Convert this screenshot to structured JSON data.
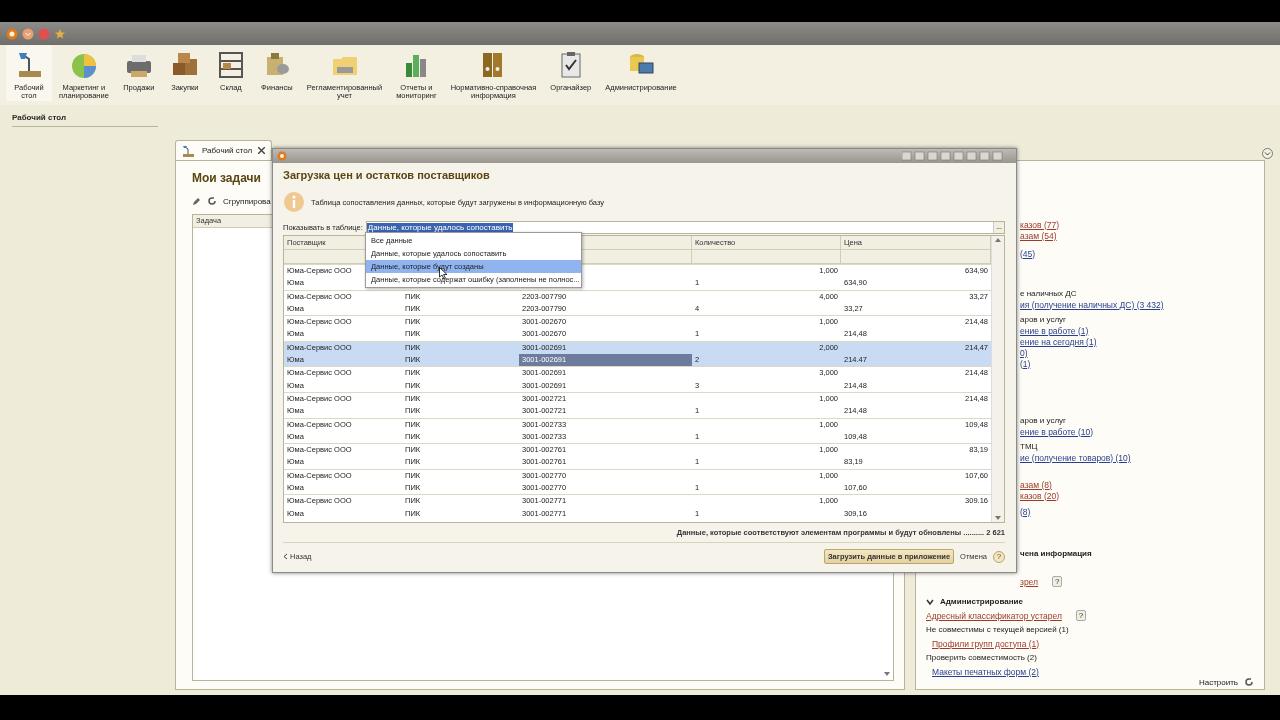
{
  "sections": [
    {
      "label": "Рабочий\nстол",
      "selected": true
    },
    {
      "label": "Маркетинг и\nпланирование",
      "selected": false
    },
    {
      "label": "Продажи",
      "selected": false
    },
    {
      "label": "Закупки",
      "selected": false
    },
    {
      "label": "Склад",
      "selected": false
    },
    {
      "label": "Финансы",
      "selected": false
    },
    {
      "label": "Регламентированный\nучет",
      "selected": false
    },
    {
      "label": "Отчеты и\nмониторинг",
      "selected": false
    },
    {
      "label": "Нормативно-справочная\nинформация",
      "selected": false
    },
    {
      "label": "Органайзер",
      "selected": false
    },
    {
      "label": "Администрирование",
      "selected": false
    }
  ],
  "sidebar": {
    "title": "Рабочий стол"
  },
  "tab": {
    "label": "Рабочий стол",
    "selected": true
  },
  "tasks_panel": {
    "title": "Мои задачи",
    "group_button": "Сгруппирова",
    "column": "Задача"
  },
  "right_panel": {
    "clipped_groups": [
      [
        {
          "kind": "link",
          "text": "казов (77)",
          "color": "#9b3b2a"
        },
        {
          "kind": "link",
          "text": "азам (54)",
          "color": "#9b3b2a"
        }
      ],
      [
        {
          "kind": "link",
          "text": "(45)",
          "color": "#2b3f8f"
        }
      ],
      [
        {
          "kind": "label",
          "text": "е наличных ДС"
        },
        {
          "kind": "link",
          "text": "ия (получение наличных ДС) (3 432)",
          "color": "#2b3f8f"
        }
      ],
      [
        {
          "kind": "label",
          "text": "аров и услуг"
        },
        {
          "kind": "link",
          "text": "ение в работе (1)",
          "color": "#2b3f8f"
        },
        {
          "kind": "link",
          "text": "ение на сегодня (1)",
          "color": "#2b3f8f"
        },
        {
          "kind": "link",
          "text": "0)",
          "color": "#2b3f8f"
        },
        {
          "kind": "link",
          "text": "(1)",
          "color": "#2b3f8f"
        }
      ],
      [
        {
          "kind": "label",
          "text": "аров и услуг"
        },
        {
          "kind": "link",
          "text": "ение в работе (10)",
          "color": "#2b3f8f"
        }
      ],
      [
        {
          "kind": "label",
          "text": "ТМЦ"
        },
        {
          "kind": "link",
          "text": "ие (получение товаров) (10)",
          "color": "#2b3f8f"
        }
      ],
      [
        {
          "kind": "link",
          "text": "азам (8)",
          "color": "#9b3b2a"
        },
        {
          "kind": "link",
          "text": "казов (20)",
          "color": "#9b3b2a"
        }
      ],
      [
        {
          "kind": "link",
          "text": "(8)",
          "color": "#2b3f8f"
        }
      ],
      [
        {
          "kind": "heading",
          "text": "чена информация"
        }
      ],
      [
        {
          "kind": "link",
          "text": "зрел",
          "color": "#9b3b2a",
          "help": "?"
        }
      ]
    ],
    "admin": {
      "title": "Администрирование",
      "expanded": true,
      "items": [
        {
          "kind": "link",
          "text": "Адресный классификатор устарел",
          "color": "#9b3b2a",
          "help": "?"
        },
        {
          "kind": "label",
          "text": "Не совместимы с текущей версией (1)"
        },
        {
          "kind": "sublink",
          "text": "Профили групп доступа (1)",
          "color": "#9b3b2a"
        },
        {
          "kind": "label",
          "text": "Проверить совместимость (2)"
        },
        {
          "kind": "sublink",
          "text": "Макеты печатных форм (2)",
          "color": "#2b3f8f"
        }
      ]
    },
    "settings_button": "Настроить"
  },
  "dialog": {
    "heading": "Загрузка цен и остатков поставщиков",
    "info": "Таблица сопоставления данных, которые будут загружены в информационную базу",
    "filter": {
      "label": "Показывать в таблице:",
      "value": "Данные, которые удалось сопоставить",
      "choice_button": "..."
    },
    "dropdown": [
      {
        "text": "Все данные",
        "selected": false
      },
      {
        "text": "Данные, которые удалось сопоставить",
        "selected": false
      },
      {
        "text": "Данные, которые будут созданы",
        "selected": true
      },
      {
        "text": "Данные, которые содержат ошибку (заполнены не полнос...",
        "selected": false
      }
    ],
    "columns": {
      "supplier": "Поставщик",
      "quantity": "Количество",
      "price": "Цена"
    },
    "records": [
      {
        "selected": false,
        "top": {
          "supplier": "Юма-Сервис ООО",
          "quantity": "1,000",
          "price": "634,90"
        },
        "bottom": {
          "supplier": "Юма",
          "quantity": "1",
          "price": "634,90"
        }
      },
      {
        "selected": false,
        "top": {
          "supplier": "Юма-Сервис ООО",
          "column_2": "ПИК",
          "column_3": "2203-007790",
          "quantity": "4,000",
          "price": "33,27"
        },
        "bottom": {
          "supplier": "Юма",
          "column_2": "ПИК",
          "column_3": "2203-007790",
          "quantity": "4",
          "price": "33,27"
        }
      },
      {
        "selected": false,
        "top": {
          "supplier": "Юма-Сервис ООО",
          "column_2": "ПИК",
          "column_3": "3001-002670",
          "quantity": "1,000",
          "price": "214,48"
        },
        "bottom": {
          "supplier": "Юма",
          "column_2": "ПИК",
          "column_3": "3001-002670",
          "quantity": "1",
          "price": "214,48"
        }
      },
      {
        "selected": true,
        "top": {
          "supplier": "Юма-Сервис ООО",
          "column_2": "ПИК",
          "column_3": "3001-002691",
          "quantity": "2,000",
          "price": "214,47"
        },
        "bottom": {
          "supplier": "Юма",
          "column_2": "ПИК",
          "column_3": "3001-002691",
          "quantity": "2",
          "price": "214.47"
        }
      },
      {
        "selected": false,
        "top": {
          "supplier": "Юма-Сервис ООО",
          "column_2": "ПИК",
          "column_3": "3001-002691",
          "quantity": "3,000",
          "price": "214,48"
        },
        "bottom": {
          "supplier": "Юма",
          "column_2": "ПИК",
          "column_3": "3001-002691",
          "quantity": "3",
          "price": "214,48"
        }
      },
      {
        "selected": false,
        "top": {
          "supplier": "Юма-Сервис ООО",
          "column_2": "ПИК",
          "column_3": "3001-002721",
          "quantity": "1,000",
          "price": "214,48"
        },
        "bottom": {
          "supplier": "Юма",
          "column_2": "ПИК",
          "column_3": "3001-002721",
          "quantity": "1",
          "price": "214,48"
        }
      },
      {
        "selected": false,
        "top": {
          "supplier": "Юма-Сервис ООО",
          "column_2": "ПИК",
          "column_3": "3001-002733",
          "quantity": "1,000",
          "price": "109,48"
        },
        "bottom": {
          "supplier": "Юма",
          "column_2": "ПИК",
          "column_3": "3001-002733",
          "quantity": "1",
          "price": "109,48"
        }
      },
      {
        "selected": false,
        "top": {
          "supplier": "Юма-Сервис ООО",
          "column_2": "ПИК",
          "column_3": "3001-002761",
          "quantity": "1,000",
          "price": "83,19"
        },
        "bottom": {
          "supplier": "Юма",
          "column_2": "ПИК",
          "column_3": "3001-002761",
          "quantity": "1",
          "price": "83,19"
        }
      },
      {
        "selected": false,
        "top": {
          "supplier": "Юма-Сервис ООО",
          "column_2": "ПИК",
          "column_3": "3001-002770",
          "quantity": "1,000",
          "price": "107,60"
        },
        "bottom": {
          "supplier": "Юма",
          "column_2": "ПИК",
          "column_3": "3001-002770",
          "quantity": "1",
          "price": "107,60"
        }
      },
      {
        "selected": false,
        "top": {
          "supplier": "Юма-Сервис ООО",
          "column_2": "ПИК",
          "column_3": "3001-002771",
          "quantity": "1,000",
          "price": "309.16"
        },
        "bottom": {
          "supplier": "Юма",
          "column_2": "ПИК",
          "column_3": "3001-002771",
          "quantity": "1",
          "price": "309,16"
        }
      }
    ],
    "summary": "Данные, которые соответствуют элементам программы и будут обновлены .......... 2 621",
    "back_button": "Назад",
    "load_button": "Загрузить данные в приложение",
    "cancel_button": "Отмена",
    "help": "?"
  }
}
